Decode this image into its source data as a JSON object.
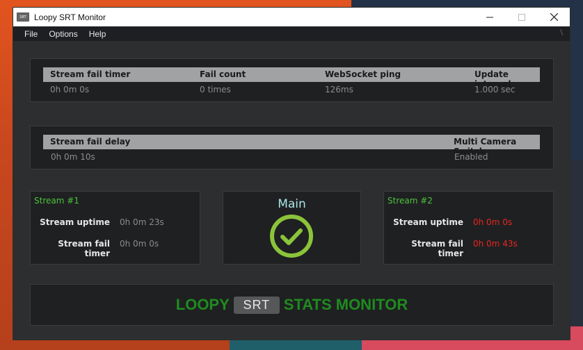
{
  "window": {
    "title": "Loopy SRT Monitor",
    "icon_text": "SRT",
    "controls": [
      "minimize-icon",
      "maximize-icon",
      "close-icon"
    ]
  },
  "menu": {
    "items": [
      "File",
      "Options",
      "Help"
    ],
    "extra": "\\"
  },
  "stats": {
    "headers": [
      "Stream fail timer",
      "Fail count",
      "WebSocket ping",
      "Update interval"
    ],
    "values": [
      "0h 0m 0s",
      "0 times",
      "126ms",
      "1.000 sec"
    ]
  },
  "settings": {
    "headers": [
      "Stream fail delay",
      "Multi Camera Switch"
    ],
    "values": [
      "0h 0m 10s",
      "Enabled"
    ]
  },
  "stream1": {
    "title": "Stream #1",
    "uptime_label": "Stream uptime",
    "uptime_value": "0h 0m 23s",
    "fail_label": "Stream fail timer",
    "fail_value": "0h 0m 0s"
  },
  "main": {
    "title": "Main",
    "status_icon": "check-circle-icon"
  },
  "stream2": {
    "title": "Stream #2",
    "uptime_label": "Stream uptime",
    "uptime_value": "0h 0m 0s",
    "fail_label": "Stream fail timer",
    "fail_value": "0h 0m 43s"
  },
  "banner": {
    "left": "LOOPY",
    "badge": "SRT",
    "right": "STATS MONITOR"
  },
  "colors": {
    "green": "#1f8b1f",
    "stream_title": "#4cc43c",
    "error": "#e8261e",
    "check": "#8bc43a"
  }
}
